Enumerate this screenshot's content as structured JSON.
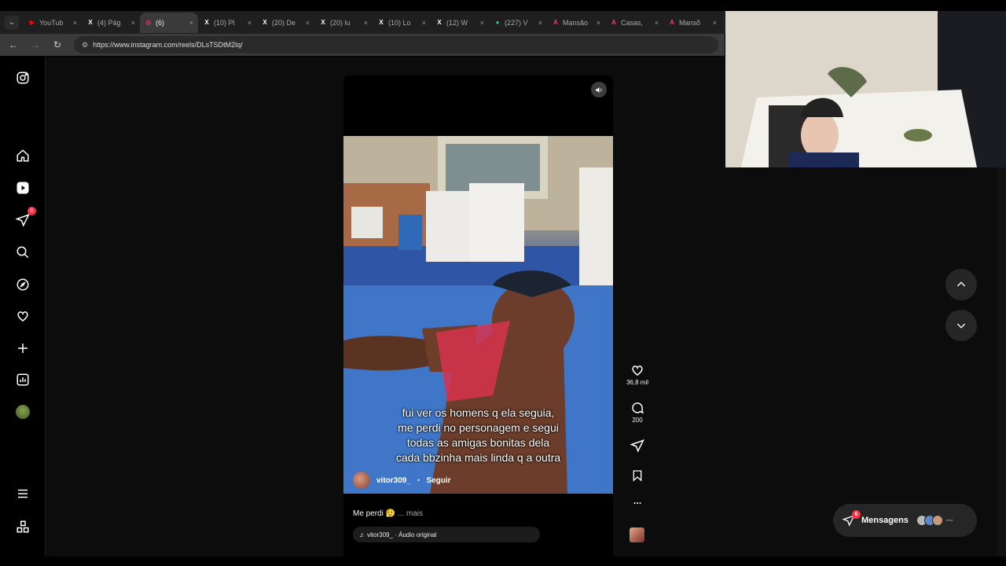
{
  "browser": {
    "tabs": [
      {
        "title": "YouTub",
        "icon": "youtube-icon",
        "color": "#ff0000",
        "glyph": "▶"
      },
      {
        "title": "(4) Pág",
        "icon": "x-icon",
        "color": "#ffffff",
        "glyph": "X"
      },
      {
        "title": "(6)",
        "icon": "instagram-icon",
        "color": "#e1306c",
        "glyph": "◎",
        "active": true
      },
      {
        "title": "(10) Pl",
        "icon": "x-icon",
        "color": "#ffffff",
        "glyph": "X"
      },
      {
        "title": "(20) De",
        "icon": "x-icon",
        "color": "#ffffff",
        "glyph": "X"
      },
      {
        "title": "(20) lu",
        "icon": "x-icon",
        "color": "#ffffff",
        "glyph": "X"
      },
      {
        "title": "(10) Lo",
        "icon": "x-icon",
        "color": "#ffffff",
        "glyph": "X"
      },
      {
        "title": "(12) W",
        "icon": "x-icon",
        "color": "#ffffff",
        "glyph": "X"
      },
      {
        "title": "(227) V",
        "icon": "whatsapp-icon",
        "color": "#25d366",
        "glyph": "●"
      },
      {
        "title": "Mansão",
        "icon": "airbnb-icon",
        "color": "#ff385c",
        "glyph": "A"
      },
      {
        "title": "Casas, ",
        "icon": "airbnb-icon",
        "color": "#ff385c",
        "glyph": "A"
      },
      {
        "title": "Mansõ",
        "icon": "airbnb-icon",
        "color": "#ff385c",
        "glyph": "A"
      }
    ],
    "tab_close": "×",
    "url": "https://www.instagram.com/reels/DLsTSDtM2lq/"
  },
  "sidebar": {
    "notification_badge": "6"
  },
  "reel": {
    "caption_lines": [
      "fui ver os homens q ela seguia,",
      "me perdi no personagem e segui",
      "todas as amigas bonitas dela",
      "cada bbzinha mais linda q a outra"
    ],
    "owner": "vitor309_",
    "separator": "•",
    "follow": "Seguir",
    "description": "Me perdi 😮‍💨",
    "more": "... mais",
    "audio": "vitor309_ · Áudio original"
  },
  "actions": {
    "likes": "36,8 mil",
    "comments": "200"
  },
  "messages": {
    "label": "Mensagens",
    "badge": "6"
  },
  "colors": {
    "accent_red": "#ff3040",
    "panel": "#262626"
  }
}
